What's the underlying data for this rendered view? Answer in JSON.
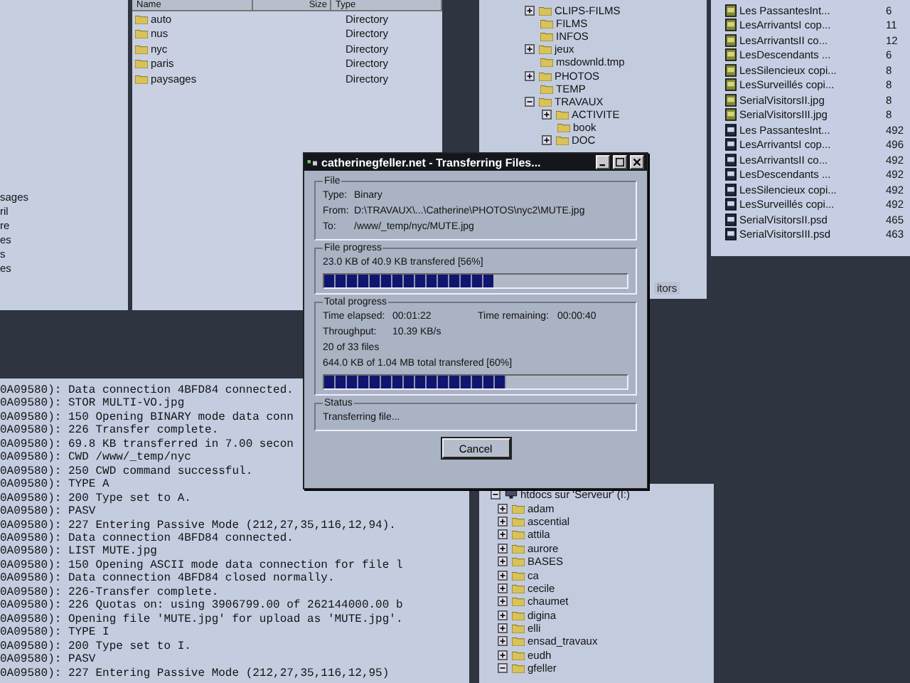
{
  "left_panel": {
    "items": [
      "sages",
      "ril",
      "re",
      "es",
      "s",
      "es"
    ]
  },
  "remote_list": {
    "columns": [
      "Name",
      "Size",
      "Type"
    ],
    "rows": [
      {
        "name": "auto",
        "type": "Directory"
      },
      {
        "name": "nus",
        "type": "Directory"
      },
      {
        "name": "nyc",
        "type": "Directory"
      },
      {
        "name": "paris",
        "type": "Directory"
      },
      {
        "name": "paysages",
        "type": "Directory"
      }
    ]
  },
  "log": {
    "lines": [
      "0A09580): Data connection 4BFD84 connected.",
      "0A09580): STOR MULTI-VO.jpg",
      "0A09580): 150 Opening BINARY mode data conn",
      "0A09580): 226 Transfer complete.",
      "0A09580): 69.8 KB transferred in 7.00 secon",
      "0A09580): CWD /www/_temp/nyc",
      "0A09580): 250 CWD command successful.",
      "0A09580): TYPE A",
      "0A09580): 200 Type set to A.",
      "0A09580): PASV",
      "0A09580): 227 Entering Passive Mode (212,27,35,116,12,94).",
      "0A09580): Data connection 4BFD84 connected.",
      "0A09580): LIST MUTE.jpg",
      "0A09580): 150 Opening ASCII mode data connection for file l",
      "0A09580): Data connection 4BFD84 closed normally.",
      "0A09580): 226-Transfer complete.",
      "0A09580): 226 Quotas on: using 3906799.00 of 262144000.00 b",
      "0A09580): Opening file 'MUTE.jpg' for upload as 'MUTE.jpg'.",
      "0A09580): TYPE I",
      "0A09580): 200 Type set to I.",
      "0A09580): PASV",
      "0A09580): 227 Entering Passive Mode (212,27,35,116,12,95)"
    ]
  },
  "local_tree": {
    "items": [
      {
        "name": "CLIPS-FILMS",
        "kind": "collapsed"
      },
      {
        "name": "FILMS",
        "kind": "leaf"
      },
      {
        "name": "INFOS",
        "kind": "leaf"
      },
      {
        "name": "jeux",
        "kind": "collapsed"
      },
      {
        "name": "msdownld.tmp",
        "kind": "leaf"
      },
      {
        "name": "PHOTOS",
        "kind": "collapsed"
      },
      {
        "name": "TEMP",
        "kind": "leaf"
      },
      {
        "name": "TRAVAUX",
        "kind": "expanded",
        "children": [
          {
            "name": "ACTIVITE",
            "kind": "collapsed"
          },
          {
            "name": "book",
            "kind": "leaf"
          },
          {
            "name": "DOC",
            "kind": "collapsed"
          }
        ]
      }
    ]
  },
  "cut_label": "itors",
  "local_files": {
    "rows": [
      {
        "name": "Les PassantesInt...",
        "size": "6",
        "kind": "jpg"
      },
      {
        "name": "LesArrivantsI cop...",
        "size": "11",
        "kind": "jpg"
      },
      {
        "name": "LesArrivantsII co...",
        "size": "12",
        "kind": "jpg"
      },
      {
        "name": "LesDescendants ...",
        "size": "6",
        "kind": "jpg"
      },
      {
        "name": "LesSilencieux copi...",
        "size": "8",
        "kind": "jpg"
      },
      {
        "name": "LesSurveillés copi...",
        "size": "8",
        "kind": "jpg"
      },
      {
        "name": "SerialVisitorsII.jpg",
        "size": "8",
        "kind": "jpg"
      },
      {
        "name": "SerialVisitorsIII.jpg",
        "size": "8",
        "kind": "jpg"
      },
      {
        "name": "Les PassantesInt...",
        "size": "492",
        "kind": "psd"
      },
      {
        "name": "LesArrivantsI cop...",
        "size": "496",
        "kind": "psd"
      },
      {
        "name": "LesArrivantsII co...",
        "size": "492",
        "kind": "psd"
      },
      {
        "name": "LesDescendants ...",
        "size": "492",
        "kind": "psd"
      },
      {
        "name": "LesSilencieux copi...",
        "size": "492",
        "kind": "psd"
      },
      {
        "name": "LesSurveillés copi...",
        "size": "492",
        "kind": "psd"
      },
      {
        "name": "SerialVisitorsII.psd",
        "size": "465",
        "kind": "psd"
      },
      {
        "name": "SerialVisitorsIII.psd",
        "size": "463",
        "kind": "psd"
      }
    ]
  },
  "server_tree": {
    "root": "htdocs sur 'Serveur' (I:)",
    "items": [
      {
        "name": "adam",
        "kind": "collapsed"
      },
      {
        "name": "ascential",
        "kind": "collapsed"
      },
      {
        "name": "attila",
        "kind": "collapsed"
      },
      {
        "name": "aurore",
        "kind": "collapsed"
      },
      {
        "name": "BASES",
        "kind": "collapsed"
      },
      {
        "name": "ca",
        "kind": "collapsed"
      },
      {
        "name": "cecile",
        "kind": "collapsed"
      },
      {
        "name": "chaumet",
        "kind": "collapsed"
      },
      {
        "name": "digina",
        "kind": "collapsed"
      },
      {
        "name": "elli",
        "kind": "collapsed"
      },
      {
        "name": "ensad_travaux",
        "kind": "collapsed"
      },
      {
        "name": "eudh",
        "kind": "collapsed"
      },
      {
        "name": "gfeller",
        "kind": "expanded"
      }
    ]
  },
  "dialog": {
    "title": "catherinegfeller.net - Transferring Files...",
    "file": {
      "legend": "File",
      "fields": [
        {
          "label": "Type:",
          "value": "Binary"
        },
        {
          "label": "From:",
          "value": "D:\\TRAVAUX\\...\\Catherine\\PHOTOS\\nyc2\\MUTE.jpg"
        },
        {
          "label": "To:",
          "value": "/www/_temp/nyc/MUTE.jpg"
        }
      ]
    },
    "file_progress": {
      "legend": "File progress",
      "text": "23.0 KB of 40.9 KB transfered [56%]",
      "level": 0.56
    },
    "total_progress": {
      "legend": "Total progress",
      "elapsed_label": "Time elapsed:",
      "elapsed": "00:01:22",
      "remaining_label": "Time remaining:",
      "remaining": "00:00:40",
      "throughput_label": "Throughput:",
      "throughput": "10.39 KB/s",
      "files": "20 of 33 files",
      "text": "644.0 KB of 1.04 MB total transfered [60%]",
      "level": 0.6
    },
    "status": {
      "legend": "Status",
      "text": "Transferring file..."
    },
    "button": "Cancel"
  }
}
